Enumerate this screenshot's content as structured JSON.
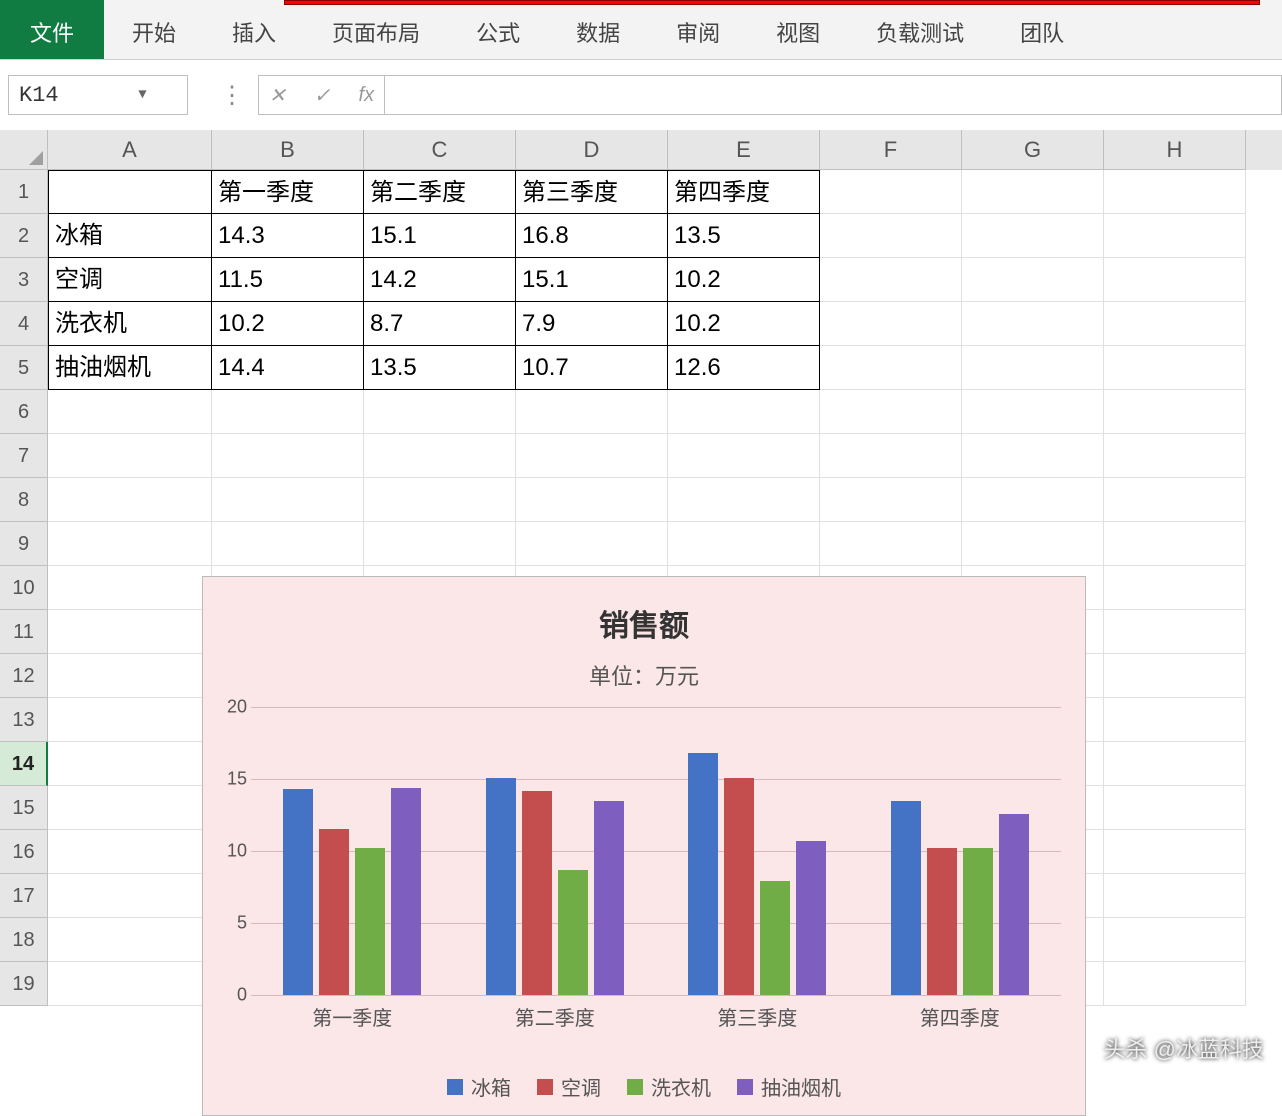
{
  "ribbon": {
    "file": "文件",
    "tabs": [
      "开始",
      "插入",
      "页面布局",
      "公式",
      "数据",
      "审阅",
      "视图",
      "负载测试",
      "团队"
    ]
  },
  "namebox": {
    "value": "K14"
  },
  "fx": {
    "label": "fx"
  },
  "columns": [
    "A",
    "B",
    "C",
    "D",
    "E",
    "F",
    "G",
    "H"
  ],
  "row_numbers": [
    1,
    2,
    3,
    4,
    5,
    6,
    7,
    8,
    9,
    10,
    11,
    12,
    13,
    14,
    15,
    16,
    17,
    18,
    19
  ],
  "active_row": 14,
  "table": {
    "headers": [
      "",
      "第一季度",
      "第二季度",
      "第三季度",
      "第四季度"
    ],
    "rows": [
      {
        "label": "冰箱",
        "v": [
          "14.3",
          "15.1",
          "16.8",
          "13.5"
        ]
      },
      {
        "label": "空调",
        "v": [
          "11.5",
          "14.2",
          "15.1",
          "10.2"
        ]
      },
      {
        "label": "洗衣机",
        "v": [
          "10.2",
          "8.7",
          "7.9",
          "10.2"
        ]
      },
      {
        "label": "抽油烟机",
        "v": [
          "14.4",
          "13.5",
          "10.7",
          "12.6"
        ]
      }
    ]
  },
  "chart_data": {
    "type": "bar",
    "title": "销售额",
    "subtitle": "单位：万元",
    "xlabel": "",
    "ylabel": "",
    "ylim": [
      0,
      20
    ],
    "yticks": [
      0,
      5,
      10,
      15,
      20
    ],
    "categories": [
      "第一季度",
      "第二季度",
      "第三季度",
      "第四季度"
    ],
    "series": [
      {
        "name": "冰箱",
        "color": "#4472c4",
        "values": [
          14.3,
          15.1,
          16.8,
          13.5
        ]
      },
      {
        "name": "空调",
        "color": "#c44e4e",
        "values": [
          11.5,
          14.2,
          15.1,
          10.2
        ]
      },
      {
        "name": "洗衣机",
        "color": "#70ad47",
        "values": [
          10.2,
          8.7,
          7.9,
          10.2
        ]
      },
      {
        "name": "抽油烟机",
        "color": "#7e5fc0",
        "values": [
          14.4,
          13.5,
          10.7,
          12.6
        ]
      }
    ]
  },
  "watermark": "头杀 @冰蓝科技"
}
